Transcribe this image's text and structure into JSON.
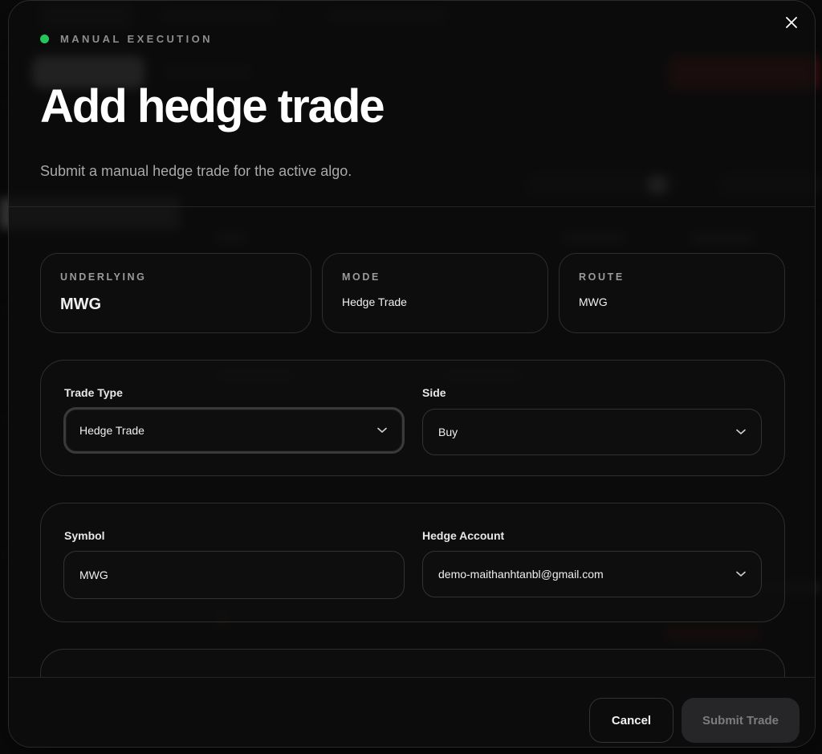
{
  "modal": {
    "eyebrow": "MANUAL EXECUTION",
    "title": "Add hedge trade",
    "subtitle": "Submit a manual hedge trade for the active algo.",
    "close_icon": "close-icon",
    "status_color": "#22c55e"
  },
  "info": {
    "underlying_label": "UNDERLYING",
    "underlying_value": "MWG",
    "mode_label": "MODE",
    "mode_value": "Hedge Trade",
    "route_label": "ROUTE",
    "route_value": "MWG"
  },
  "form": {
    "trade_type_label": "Trade Type",
    "trade_type_value": "Hedge Trade",
    "side_label": "Side",
    "side_value": "Buy",
    "symbol_label": "Symbol",
    "symbol_value": "MWG",
    "hedge_account_label": "Hedge Account",
    "hedge_account_value": "demo-maithanhtanbl@gmail.com"
  },
  "footer": {
    "cancel_label": "Cancel",
    "submit_label": "Submit Trade"
  }
}
